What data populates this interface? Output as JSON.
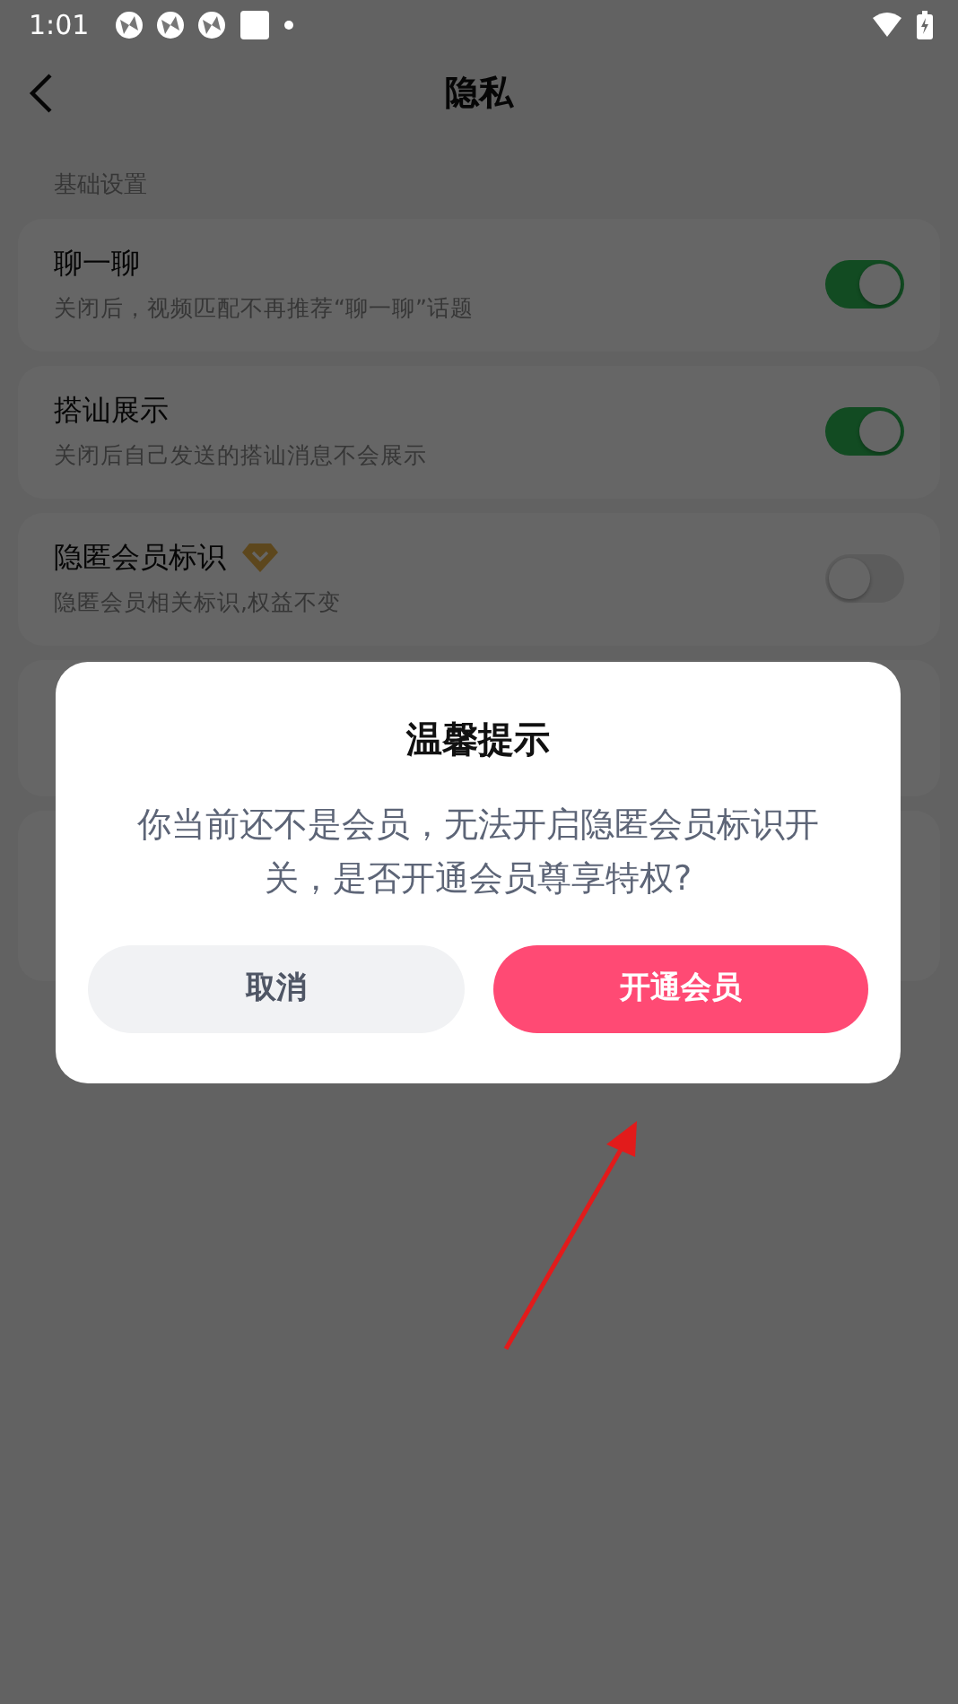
{
  "status_bar": {
    "time": "1:01"
  },
  "header": {
    "title": "隐私"
  },
  "section_label": "基础设置",
  "settings": [
    {
      "kind": "plain",
      "title": "聊一聊",
      "subtitle": "关闭后，视频匹配不再推荐“聊一聊”话题",
      "on": true
    },
    {
      "kind": "plain",
      "title": "搭讪展示",
      "subtitle": "关闭后自己发送的搭讪消息不会展示",
      "on": true
    },
    {
      "kind": "member",
      "title": "隐匿会员标识",
      "subtitle": "隐匿会员相关标识,权益不变",
      "on": false
    }
  ],
  "dialog": {
    "title": "温馨提示",
    "message": "你当前还不是会员，无法开启隐匿会员标识开关，是否开通会员尊享特权?",
    "buttons": [
      {
        "kind": "secondary",
        "label": "取消"
      },
      {
        "kind": "primary",
        "label": "开通会员"
      }
    ]
  }
}
